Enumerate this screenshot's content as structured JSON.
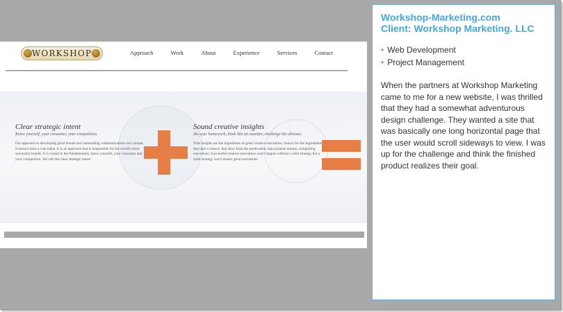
{
  "screenshot": {
    "logo_text": "WORKSHOP",
    "nav": [
      "Approach",
      "Work",
      "About",
      "Experience",
      "Services",
      "Contact"
    ],
    "block1": {
      "title": "Clear strategic intent",
      "subtitle": "Know yourself, your consumer, your competition.",
      "body": "Our approach to developing great brands and outstanding communications isn't unique. It doesn't have a cute name. It is an approach that is responsible for the world's most successful brands. It is rooted in the fundamentals: know yourself, your consumer and your competition. We call this clear strategic intent."
    },
    "block2": {
      "title": "Sound creative insights",
      "subtitle": "Do your homework, think like an outsider, challenge the obvious.",
      "body": "True insights are the ingredients of great creative executions. Search for the ingredients that take a chance, that stray from the predictable, that promise unique, compelling executions. Successful creative executions won't happen without a solid strategy but a solid strategy won't ensure great executions."
    },
    "accent_color": "#e67e45"
  },
  "panel": {
    "title_line1": "Workshop-Marketing.com",
    "title_line2": "Client: Workshop Marketing. LLC",
    "services": [
      "Web Development",
      "Project Management"
    ],
    "description": "When the partners at Workshop Marketing came to me for a new website, I was thrilled that they had a somewhat adventurous design challenge. They wanted a site that was basically one long horizontal page that the user would scroll sideways to view. I was up for the challenge and think the finished product realizes their goal.",
    "accent_color": "#3fa9e0"
  }
}
